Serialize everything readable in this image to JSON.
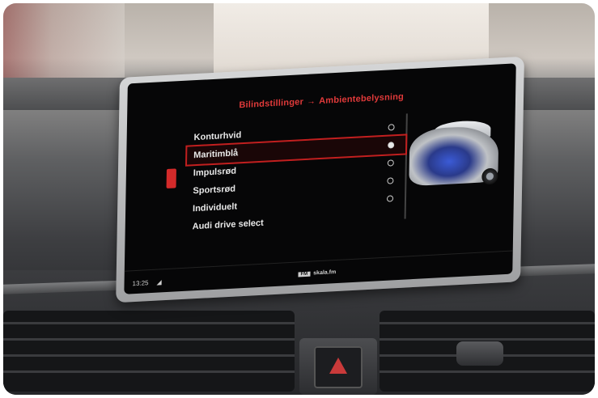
{
  "screen": {
    "breadcrumb_parent": "Bilindstillinger",
    "breadcrumb_separator": "→",
    "breadcrumb_current": "Ambientebelysning",
    "options": [
      {
        "label": "Konturhvid",
        "selected": false
      },
      {
        "label": "Maritimblå",
        "selected": true
      },
      {
        "label": "Impulsrød",
        "selected": false
      },
      {
        "label": "Sportsrød",
        "selected": false
      },
      {
        "label": "Individuelt",
        "selected": false
      },
      {
        "label": "Audi drive select",
        "selected": false
      }
    ],
    "status": {
      "time": "13:25",
      "signal": "◢",
      "source_badge": "FM",
      "source_label": "skala.fm"
    }
  },
  "colors": {
    "accent": "#e13a3a",
    "ambient": "#3b5bd6"
  }
}
